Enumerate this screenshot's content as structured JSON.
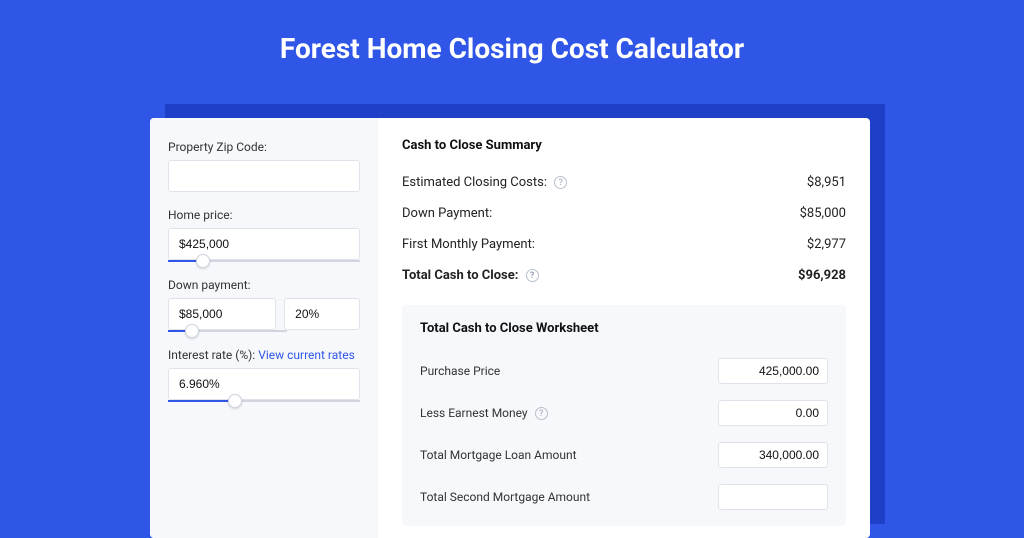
{
  "page": {
    "title": "Forest Home Closing Cost Calculator"
  },
  "sidebar": {
    "zip": {
      "label": "Property Zip Code:",
      "value": ""
    },
    "home_price": {
      "label": "Home price:",
      "value": "$425,000",
      "slider_pct": 18
    },
    "down_payment": {
      "label": "Down payment:",
      "value": "$85,000",
      "pct": "20%",
      "slider_pct": 20
    },
    "interest_rate": {
      "label": "Interest rate (%):",
      "link": "View current rates",
      "value": "6.960%",
      "slider_pct": 35
    }
  },
  "summary": {
    "title": "Cash to Close Summary",
    "rows": [
      {
        "label": "Estimated Closing Costs:",
        "help": true,
        "value": "$8,951"
      },
      {
        "label": "Down Payment:",
        "help": false,
        "value": "$85,000"
      },
      {
        "label": "First Monthly Payment:",
        "help": false,
        "value": "$2,977"
      }
    ],
    "total": {
      "label": "Total Cash to Close:",
      "help": true,
      "value": "$96,928"
    }
  },
  "worksheet": {
    "title": "Total Cash to Close Worksheet",
    "rows": [
      {
        "label": "Purchase Price",
        "help": false,
        "value": "425,000.00"
      },
      {
        "label": "Less Earnest Money",
        "help": true,
        "value": "0.00"
      },
      {
        "label": "Total Mortgage Loan Amount",
        "help": false,
        "value": "340,000.00"
      },
      {
        "label": "Total Second Mortgage Amount",
        "help": false,
        "value": ""
      }
    ]
  }
}
